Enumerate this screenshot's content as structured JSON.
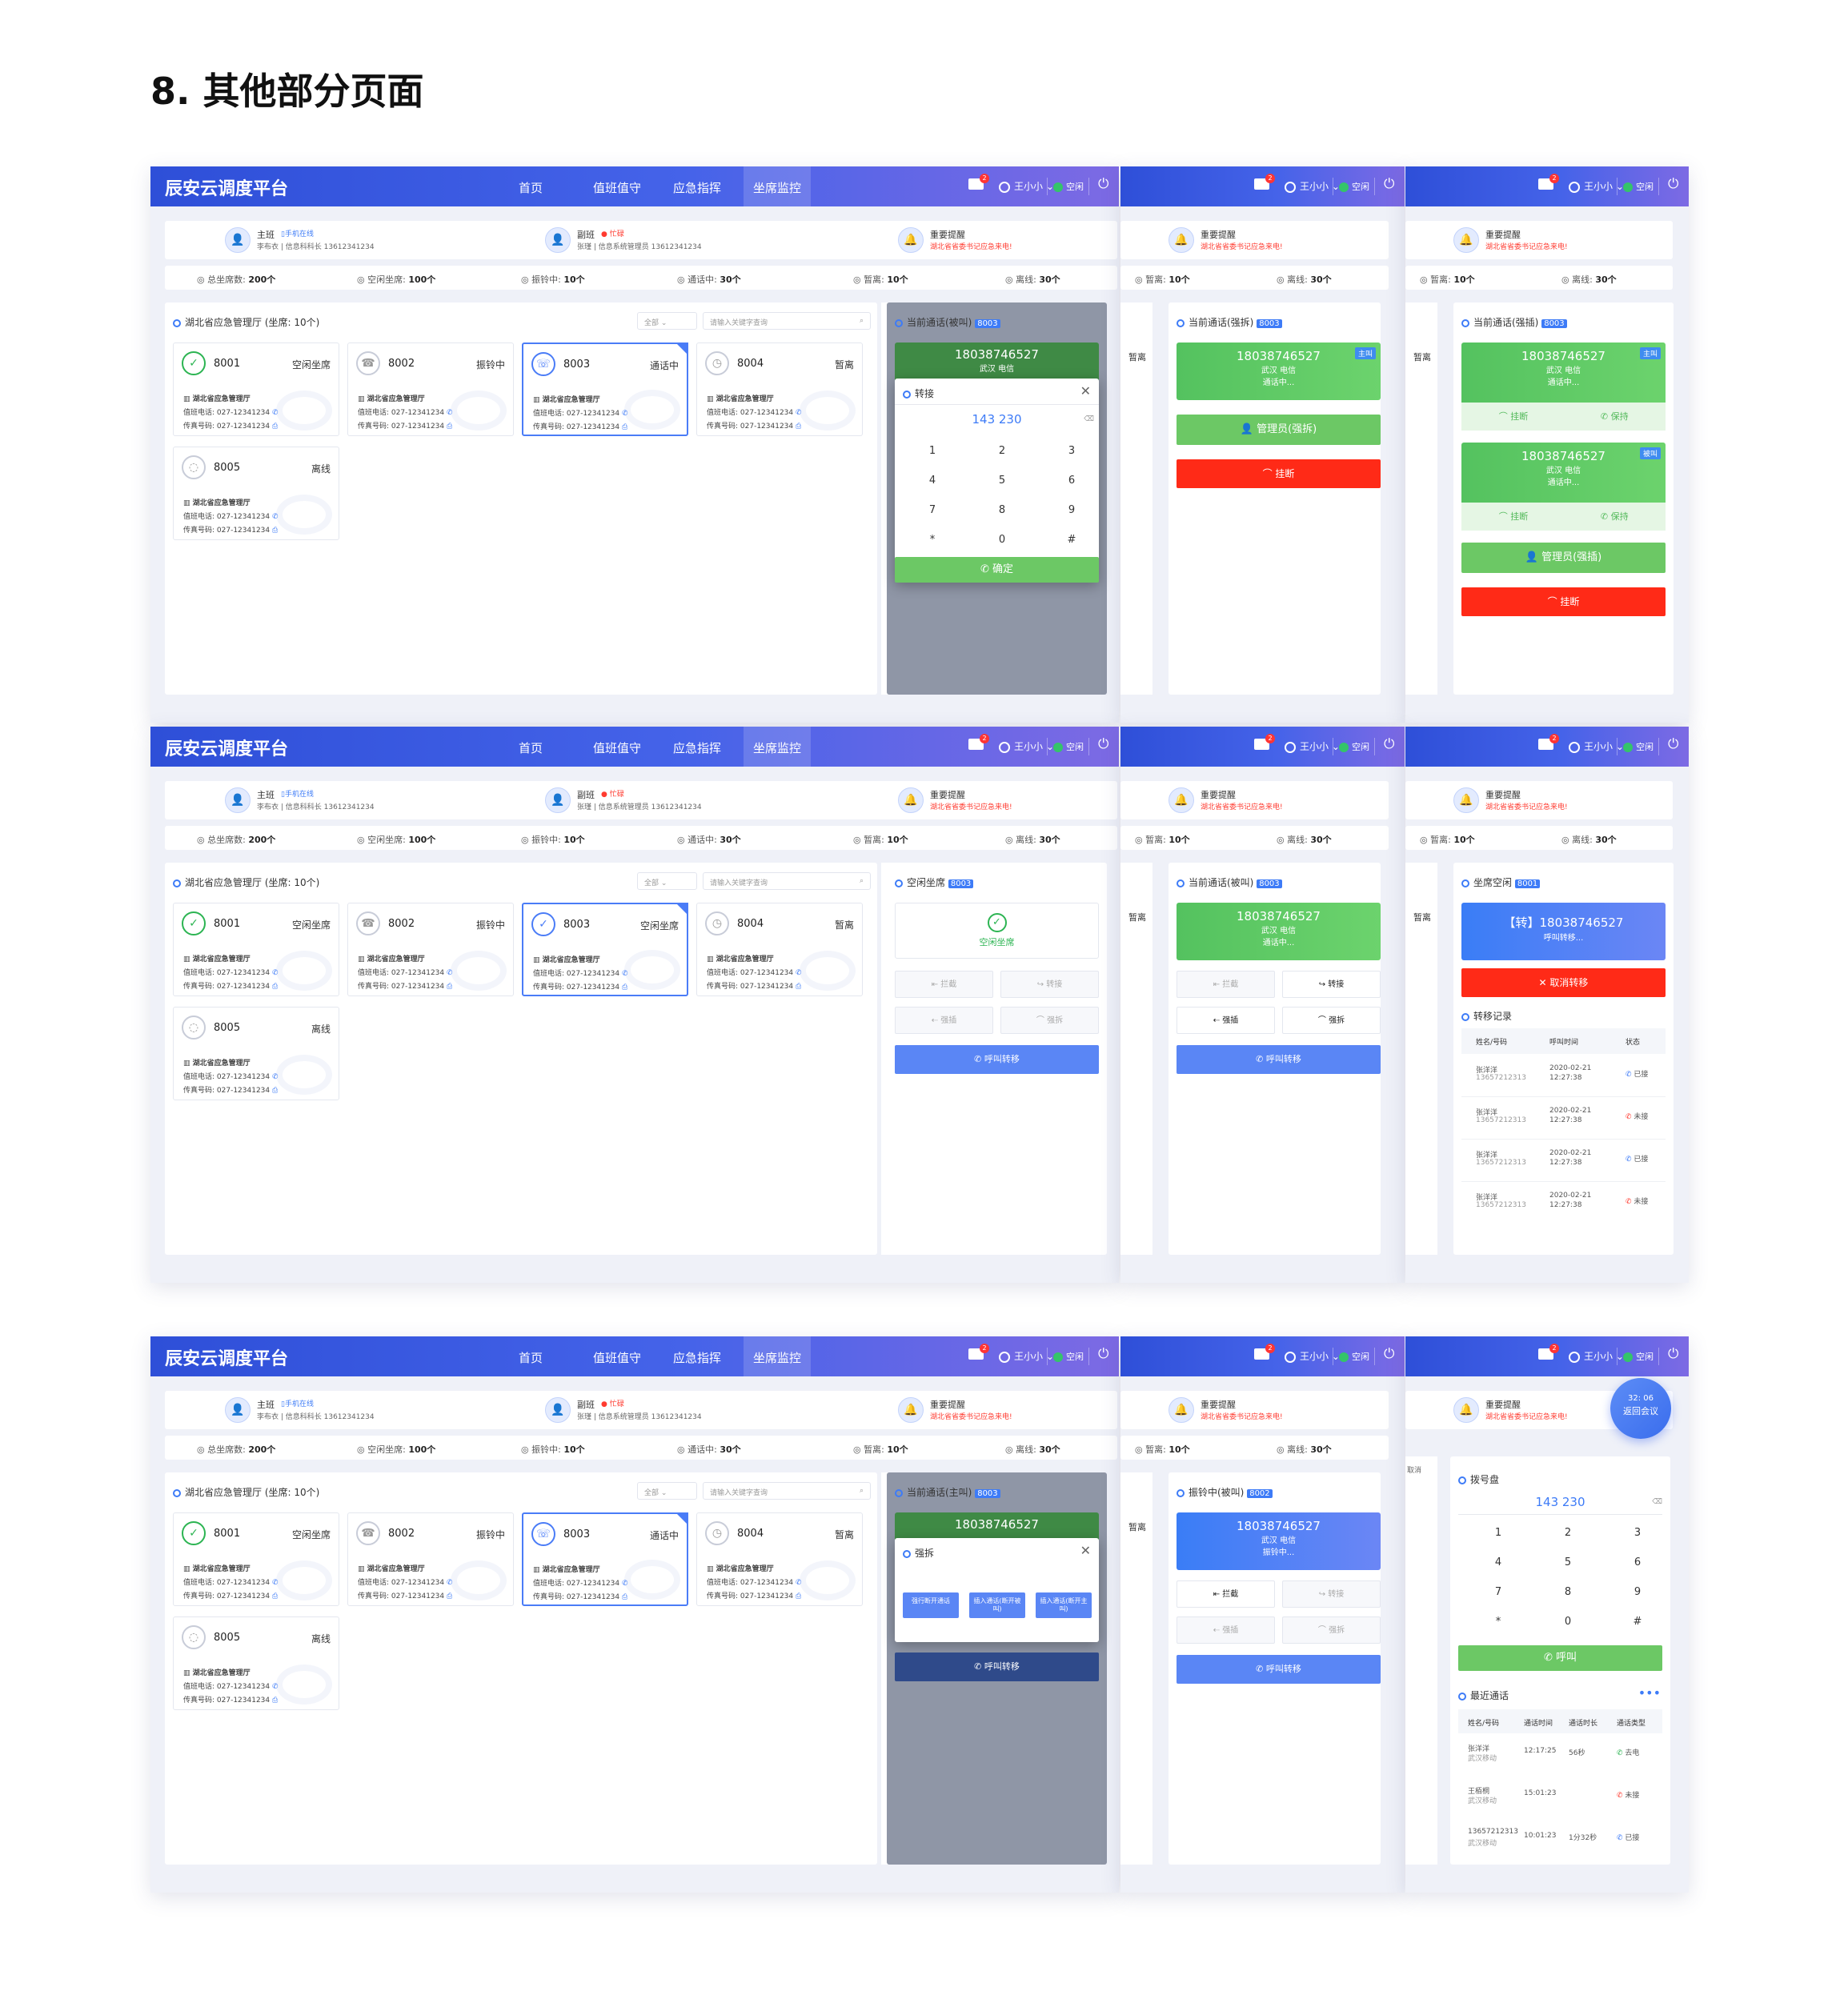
{
  "heading": "8. 其他部分页面",
  "brand": "辰安云调度平台",
  "nav": [
    "首页",
    "值班值守",
    "应急指挥",
    "坐席监控"
  ],
  "user": "王小小",
  "status": "空闲",
  "mail_badge": "2",
  "info": {
    "main_role": "主班",
    "main_tag": "手机在线",
    "main_detail": "李布衣 | 信息科科长 13612341234",
    "vice_role": "副班",
    "vice_tag": "忙碌",
    "vice_detail": "张瑾 | 信息系统管理员 13612341234",
    "alert_title": "重要提醒",
    "alert_text": "湖北省省委书记应急来电!"
  },
  "stats": {
    "total_label": "总坐席数:",
    "total": "200个",
    "idle_label": "空闲坐席:",
    "idle": "100个",
    "ringing_label": "振铃中:",
    "ringing": "10个",
    "talking_label": "通话中:",
    "talking": "30个",
    "away_label": "暂离:",
    "away": "10个",
    "offline_label": "离线:",
    "offline": "30个"
  },
  "org": "湖北省应急管理厅 (坐席: 10个)",
  "filter": "全部",
  "search_placeholder": "请输入关键字查询",
  "cards": [
    {
      "num": "8001",
      "status": "空闲坐席"
    },
    {
      "num": "8002",
      "status": "振铃中"
    },
    {
      "num": "8003",
      "status": "通话中"
    },
    {
      "num": "8004",
      "status": "暂离"
    },
    {
      "num": "8005",
      "status": "离线"
    }
  ],
  "card_org": "湖北省应急管理厅",
  "card_duty": "值班电话: 027-12341234",
  "card_fax": "传真号码: 027-12341234",
  "idle_seat": "空闲坐席",
  "away_short": "暂离",
  "phone": "18038746527",
  "location": "武汉 电信",
  "in_call": "通话中...",
  "ringing_text": "振铃中...",
  "main_call": "主叫",
  "callee": "被叫",
  "seat_8003": "8003",
  "seat_8001": "8001",
  "seat_8002": "8002",
  "current_callee": "当前通话(被叫)",
  "current_force": "当前通话(强拆)",
  "current_insert": "当前通话(强插)",
  "current_caller": "当前通话(主叫)",
  "idle_title": "空闲坐席",
  "ringing_title": "振铃中(被叫)",
  "seat_idle_title": "坐席空闲",
  "transfer": "转接",
  "dial_value": "143 230",
  "keys": [
    "1",
    "2",
    "3",
    "4",
    "5",
    "6",
    "7",
    "8",
    "9",
    "*",
    "0",
    "#"
  ],
  "confirm": "确定",
  "hangup": "挂断",
  "hold": "保持",
  "admin_force": "管理员(强拆)",
  "admin_insert": "管理员(强插)",
  "intercept": "拦截",
  "force_insert": "强插",
  "force_break": "强拆",
  "call_transfer": "呼叫转移",
  "transfer_calling": "【转】18038746527",
  "transfer_sub": "呼叫转移...",
  "cancel_transfer": "取消转移",
  "transfer_record": "转移记录",
  "rec_cols": [
    "姓名/号码",
    "呼叫时间",
    "状态"
  ],
  "records": [
    {
      "name": "张洋洋",
      "num": "13657212313",
      "date": "2020-02-21",
      "time": "12:27:38",
      "state": "已接"
    },
    {
      "name": "张洋洋",
      "num": "13657212313",
      "date": "2020-02-21",
      "time": "12:27:38",
      "state": "未接"
    },
    {
      "name": "张洋洋",
      "num": "13657212313",
      "date": "2020-02-21",
      "time": "12:27:38",
      "state": "已接"
    },
    {
      "name": "张洋洋",
      "num": "13657212313",
      "date": "2020-02-21",
      "time": "12:27:38",
      "state": "未接"
    }
  ],
  "force_break_modal": "强拆",
  "fb_options": [
    "强行断开通话",
    "插入通话(断开被叫)",
    "插入通话(断开主叫)"
  ],
  "dialpad_title": "拨号盘",
  "call_btn": "呼叫",
  "recent_title": "最近通话",
  "recent_cols": [
    "姓名/号码",
    "通话时间",
    "通话时长",
    "通话类型"
  ],
  "recent": [
    {
      "name": "张洋洋",
      "sub": "武汉移动",
      "time": "12:17:25",
      "dur": "56秒",
      "type": "去电"
    },
    {
      "name": "王栢桐",
      "sub": "武汉移动",
      "time": "15:01:23",
      "dur": "",
      "type": "未接"
    },
    {
      "name": "13657212313",
      "sub": "武汉移动",
      "time": "10:01:23",
      "dur": "1分32秒",
      "type": "已接"
    }
  ],
  "meeting_time": "32: 06",
  "meeting_label": "返回会议",
  "cancel_small": "取消"
}
